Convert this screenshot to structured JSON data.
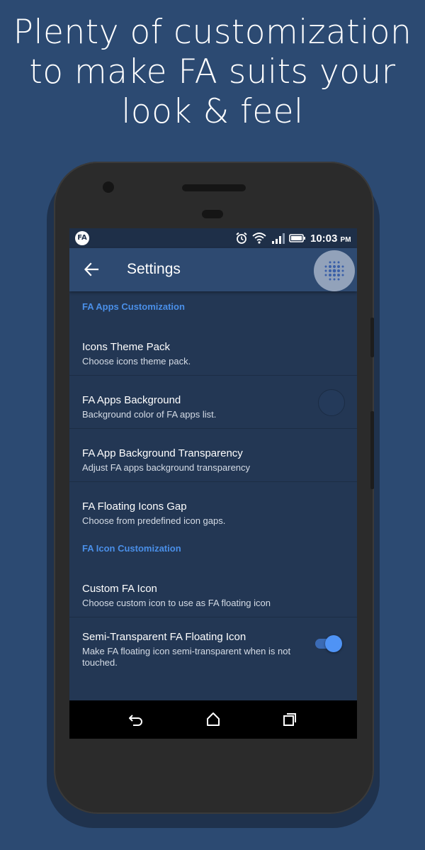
{
  "headline": {
    "line1": "Plenty of customization",
    "line2": "to make FA suits your",
    "line3": "look & feel"
  },
  "statusbar": {
    "app_badge": "FA",
    "time": "10:03",
    "ampm": "PM",
    "icons": [
      "alarm-icon",
      "wifi-icon",
      "signal-icon",
      "battery-icon"
    ]
  },
  "appbar": {
    "title": "Settings",
    "back_icon": "arrow-left-icon",
    "floating_icon": "fa-floating-dots-icon"
  },
  "sections": [
    {
      "header": "FA Apps Customization",
      "items": [
        {
          "title": "Icons Theme Pack",
          "subtitle": "Choose icons theme pack."
        },
        {
          "title": "FA Apps Background",
          "subtitle": "Background color of FA apps list.",
          "swatch_color": "#243a5a"
        },
        {
          "title": "FA App Background Transparency",
          "subtitle": "Adjust FA apps background transparency"
        },
        {
          "title": "FA Floating Icons Gap",
          "subtitle": "Choose from predefined icon gaps."
        }
      ]
    },
    {
      "header": "FA Icon Customization",
      "items": [
        {
          "title": "Custom FA Icon",
          "subtitle": "Choose custom icon to use as FA floating icon"
        },
        {
          "title": "Semi-Transparent FA Floating Icon",
          "subtitle": "Make FA floating icon semi-transparent when is not touched.",
          "toggle_on": true
        }
      ]
    }
  ],
  "navbar": {
    "icons": [
      "back-nav-icon",
      "home-nav-icon",
      "recents-nav-icon"
    ]
  },
  "colors": {
    "background": "#2c4a72",
    "screen": "#233754",
    "appbar": "#2e4a71",
    "accent": "#4a8fe8",
    "toggle": "#4f93f5"
  }
}
